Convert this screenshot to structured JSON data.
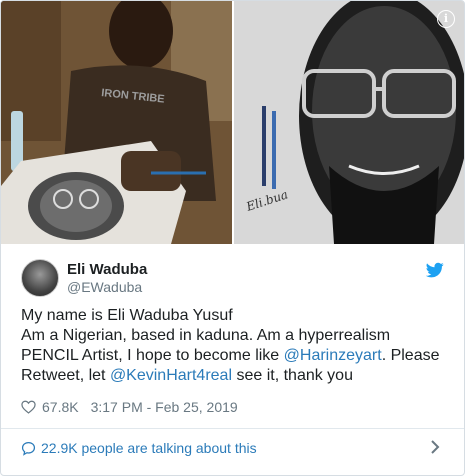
{
  "user": {
    "display_name": "Eli Waduba",
    "handle": "@EWaduba"
  },
  "tweet": {
    "line1": "My name is Eli Waduba Yusuf",
    "line2_part1": "Am a Nigerian, based in kaduna. Am a hyperrealism PENCIL Artist, I hope to become like ",
    "mention1": "@Harinzeyart",
    "line2_part2": ". Please Retweet, let ",
    "mention2": "@KevinHart4real",
    "line2_part3": " see it, thank you"
  },
  "meta": {
    "likes": "67.8K",
    "timestamp": "3:17 PM - Feb 25, 2019"
  },
  "footer": {
    "talking": "22.9K people are talking about this"
  },
  "icons": [
    "info-icon",
    "twitter-bird-icon",
    "heart-icon",
    "comment-bubble-icon",
    "chevron-right-icon"
  ],
  "colors": {
    "link": "#2b7bb9",
    "text": "#1c2022",
    "muted": "#697882"
  }
}
